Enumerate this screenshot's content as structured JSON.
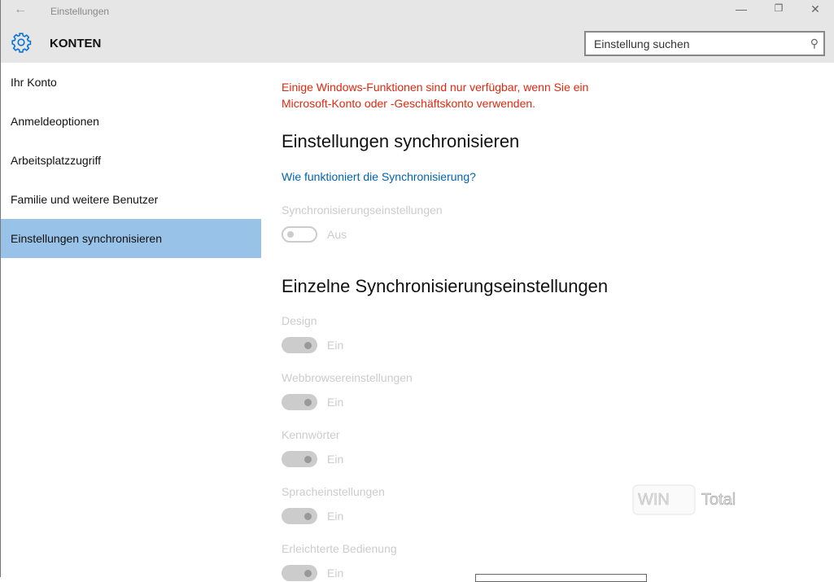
{
  "window": {
    "title": "Einstellungen",
    "back_icon": "arrow-left-icon",
    "minimize": "—",
    "restore": "❐",
    "close": "✕"
  },
  "header": {
    "title": "KONTEN",
    "search_placeholder": "Einstellung suchen",
    "search_value": ""
  },
  "sidebar": {
    "items": [
      {
        "label": "Ihr Konto"
      },
      {
        "label": "Anmeldeoptionen"
      },
      {
        "label": "Arbeitsplatzzugriff"
      },
      {
        "label": "Familie und weitere Benutzer"
      },
      {
        "label": "Einstellungen synchronisieren",
        "active": true
      }
    ]
  },
  "main": {
    "warning": "Einige Windows-Funktionen sind nur verfügbar, wenn Sie ein Microsoft-Konto oder -Geschäftskonto verwenden.",
    "heading1": "Einstellungen synchronisieren",
    "help_link": "Wie funktioniert die Synchronisierung?",
    "sync_label": "Synchronisierungseinstellungen",
    "sync_state": "Aus",
    "heading2": "Einzelne Synchronisierungseinstellungen",
    "items": [
      {
        "label": "Design",
        "state": "Ein"
      },
      {
        "label": "Webbrowsereinstellungen",
        "state": "Ein"
      },
      {
        "label": "Kennwörter",
        "state": "Ein"
      },
      {
        "label": "Spracheinstellungen",
        "state": "Ein"
      },
      {
        "label": "Erleichterte Bedienung",
        "state": "Ein"
      }
    ]
  },
  "watermark": "WinTotal",
  "colors": {
    "accent": "#0063b1",
    "warning": "#e0280f",
    "selected": "#99c2e8"
  }
}
